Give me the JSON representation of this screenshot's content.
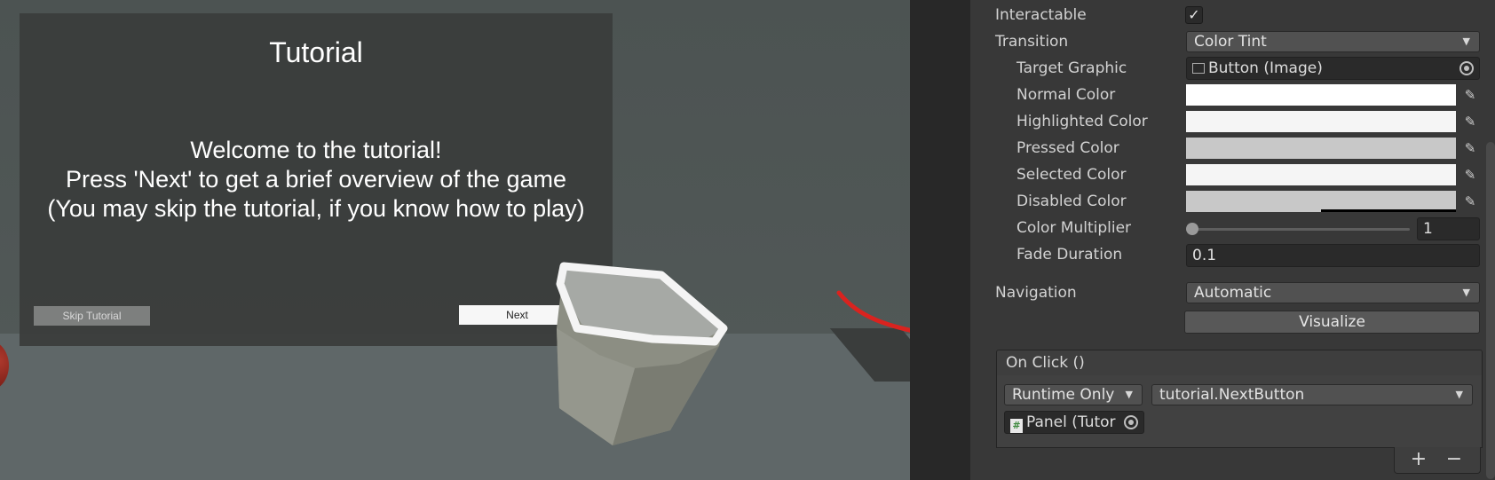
{
  "scene": {
    "tutorial_panel": {
      "title": "Tutorial",
      "body_lines": [
        "Welcome to the tutorial!",
        "Press 'Next' to get a brief overview of the game",
        "(You may skip the tutorial, if you know how to play)"
      ],
      "skip_button": "Skip Tutorial",
      "next_button": "Next"
    },
    "arrow_color": "#d9231f"
  },
  "inspector": {
    "interactable": {
      "label": "Interactable",
      "checked_glyph": "✓"
    },
    "transition": {
      "label": "Transition",
      "value": "Color Tint"
    },
    "target_graphic": {
      "label": "Target Graphic",
      "value": "Button (Image)"
    },
    "colors": [
      {
        "label": "Normal Color",
        "color": "#ffffff"
      },
      {
        "label": "Highlighted Color",
        "color": "#f5f5f5"
      },
      {
        "label": "Pressed Color",
        "color": "#c8c8c8"
      },
      {
        "label": "Selected Color",
        "color": "#f5f5f5"
      },
      {
        "label": "Disabled Color",
        "color": "#c8c8c8"
      }
    ],
    "color_multiplier": {
      "label": "Color Multiplier",
      "value": "1"
    },
    "fade_duration": {
      "label": "Fade Duration",
      "value": "0.1"
    },
    "navigation": {
      "label": "Navigation",
      "value": "Automatic"
    },
    "visualize_button": "Visualize",
    "on_click": {
      "header": "On Click ()",
      "runtime": "Runtime Only",
      "function": "tutorial.NextButton",
      "object": "Panel (Tutor",
      "object_icon": "#",
      "add": "+",
      "remove": "−"
    }
  }
}
